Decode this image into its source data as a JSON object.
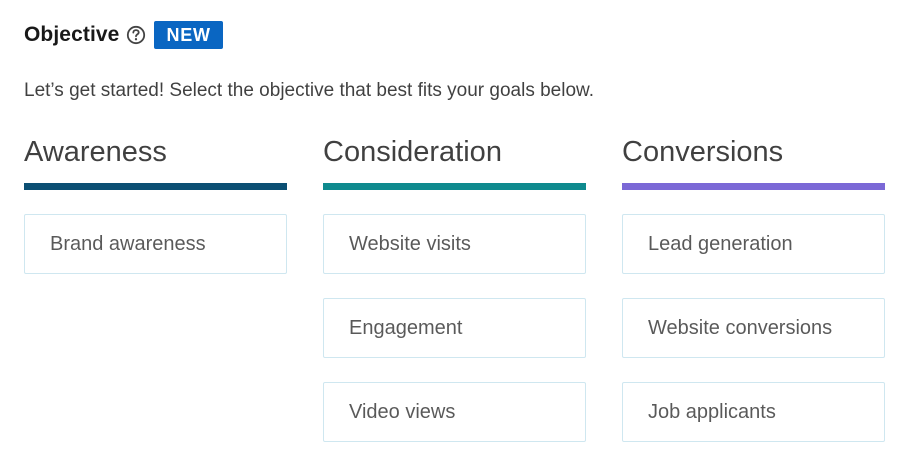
{
  "header": {
    "title": "Objective",
    "help_icon": "question-circle-icon",
    "badge": "NEW"
  },
  "subtitle": "Let’s get started! Select the objective that best fits your goals below.",
  "colors": {
    "badge_bg": "#0a66c2",
    "awareness_bar": "#0b4f73",
    "consideration_bar": "#0e8a8e",
    "conversions_bar": "#7b68d6",
    "option_border": "#cfe7f0"
  },
  "columns": [
    {
      "heading": "Awareness",
      "options": [
        {
          "label": "Brand awareness"
        }
      ]
    },
    {
      "heading": "Consideration",
      "options": [
        {
          "label": "Website visits"
        },
        {
          "label": "Engagement"
        },
        {
          "label": "Video views"
        }
      ]
    },
    {
      "heading": "Conversions",
      "options": [
        {
          "label": "Lead generation"
        },
        {
          "label": "Website conversions"
        },
        {
          "label": "Job applicants"
        }
      ]
    }
  ]
}
